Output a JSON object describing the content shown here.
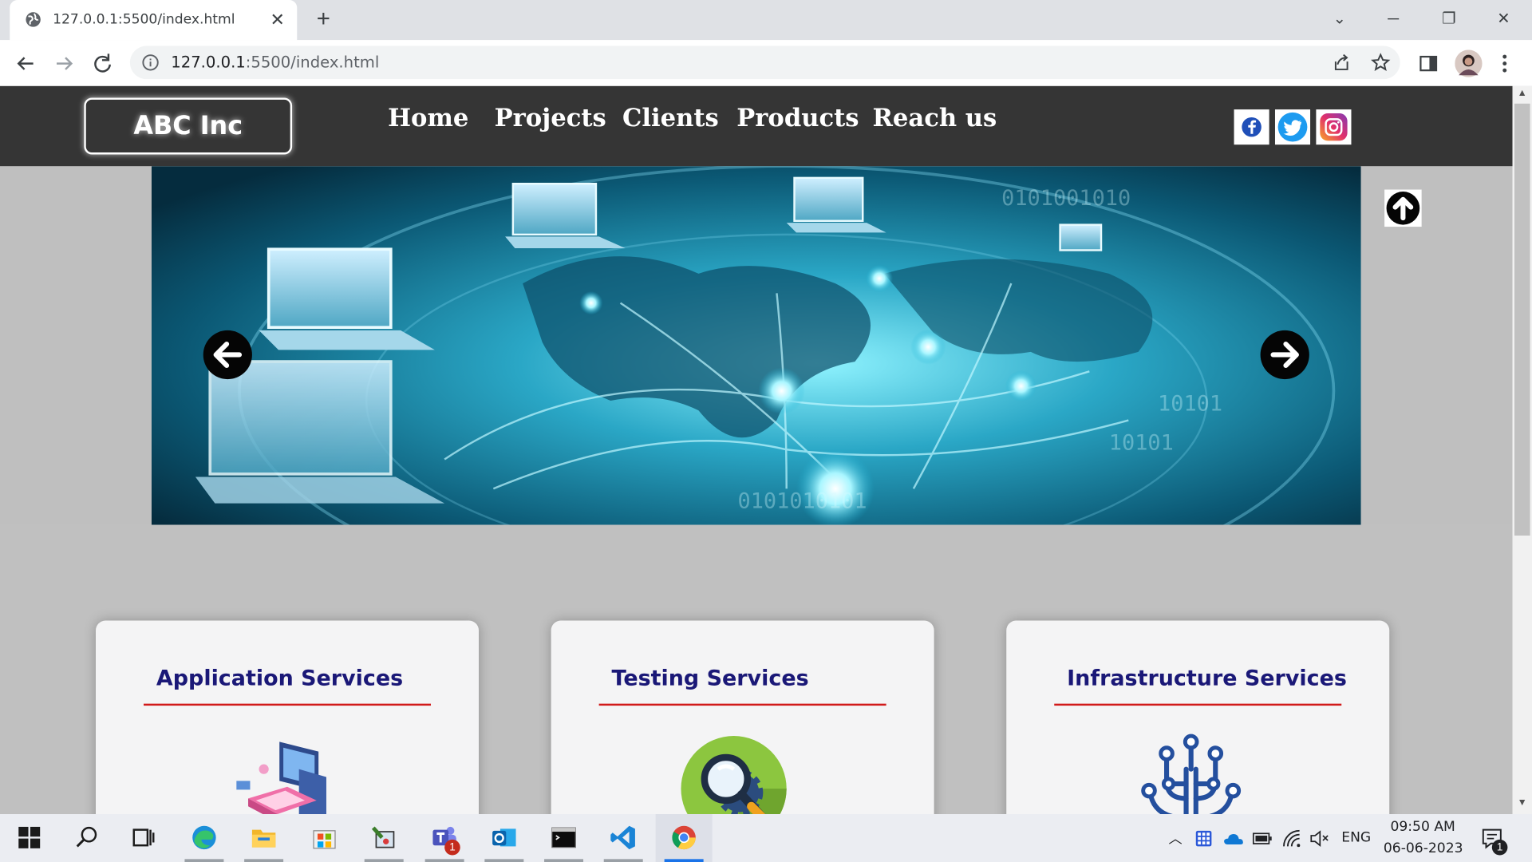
{
  "browser": {
    "tab_title": "127.0.0.1:5500/index.html",
    "url_host": "127.0.0.1",
    "url_rest": ":5500/index.html"
  },
  "site": {
    "logo": "ABC Inc",
    "nav": [
      "Home",
      "Projects",
      "Clients",
      "Products",
      "Reach us"
    ],
    "social": [
      "facebook-icon",
      "twitter-icon",
      "instagram-icon"
    ]
  },
  "services": [
    {
      "title": "Application Services",
      "icon": "laptop-isometric-icon"
    },
    {
      "title": "Testing Services",
      "icon": "magnifier-gear-icon"
    },
    {
      "title": "Infrastructure Services",
      "icon": "circuit-tree-icon"
    }
  ],
  "taskbar": {
    "language": "ENG",
    "time": "09:50 AM",
    "date": "06-06-2023",
    "teams_badge": "1",
    "notification_badge": "1"
  },
  "colors": {
    "header_bg": "#353535",
    "card_title": "#1a1877",
    "card_underline": "#d11a1a"
  }
}
